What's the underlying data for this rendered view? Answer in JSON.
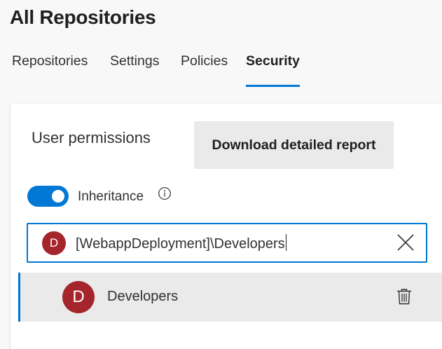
{
  "header": {
    "title": "All Repositories"
  },
  "tabs": [
    {
      "label": "Repositories",
      "active": false
    },
    {
      "label": "Settings",
      "active": false
    },
    {
      "label": "Policies",
      "active": false
    },
    {
      "label": "Security",
      "active": true
    }
  ],
  "panel": {
    "title": "User permissions",
    "download_button": "Download detailed report",
    "inheritance": {
      "label": "Inheritance",
      "enabled": true,
      "info_icon": "info-icon"
    }
  },
  "search": {
    "avatar_initial": "D",
    "value": "[WebappDeployment]\\Developers",
    "clear_icon": "close-icon"
  },
  "results": [
    {
      "initial": "D",
      "name": "Developers",
      "action_icon": "trash-icon",
      "selected": true
    }
  ],
  "colors": {
    "accent": "#0078d4",
    "avatar": "#a4262c",
    "button_bg": "#eaeaea",
    "page_bg": "#f8f8f8"
  }
}
